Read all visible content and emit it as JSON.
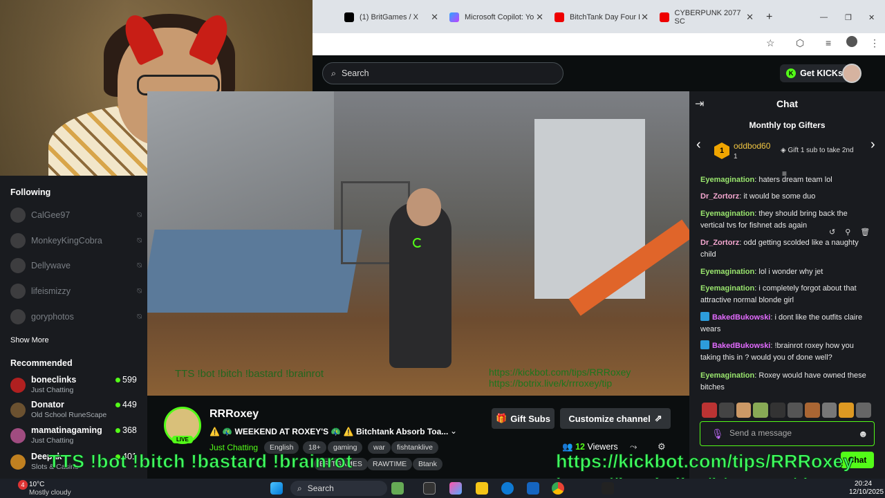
{
  "browser": {
    "tabs": [
      {
        "label": "(1) BritGames / X",
        "color": "#000000"
      },
      {
        "label": "Microsoft Copilot: Yo",
        "color": "#8a5cf6"
      },
      {
        "label": "BitchTank Day Four I",
        "color": "#53fc18"
      },
      {
        "label": "CYBERPUNK 2077 SC",
        "color": "#ff0000"
      }
    ]
  },
  "header": {
    "search_placeholder": "Search",
    "get_kicks_label": "Get KICKs"
  },
  "sidebar": {
    "following_heading": "Following",
    "following": [
      "CalGee97",
      "MonkeyKingCobra",
      "Dellywave",
      "lifeismizzy",
      "goryphotos"
    ],
    "show_more": "Show More",
    "recommended_heading": "Recommended",
    "recommended": [
      {
        "name": "boneclinks",
        "category": "Just Chatting",
        "viewers": "599"
      },
      {
        "name": "Donator",
        "category": "Old School RuneScape",
        "viewers": "449"
      },
      {
        "name": "mamatinagaming",
        "category": "Just Chatting",
        "viewers": "368"
      },
      {
        "name": "Deepak",
        "category": "Slots & Casino",
        "viewers": "401"
      }
    ]
  },
  "channel": {
    "name": "RRRoxey",
    "live_badge": "LIVE",
    "title": "⚠️ 🦚 WEEKEND AT ROXEY'S 🦚 ⚠️ Bitchtank Absorb Toa...",
    "category": "Just Chatting",
    "tags": [
      "English",
      "18+",
      "gaming",
      "war",
      "fishtanklive",
      "BRITGAMES",
      "RAWTIME",
      "Btank"
    ],
    "gift_subs_label": "Gift Subs",
    "customize_label": "Customize channel",
    "viewers_count": "12",
    "viewers_label": "Viewers"
  },
  "chat": {
    "title": "Chat",
    "gifters_title": "Monthly top Gifters",
    "top_gifter": {
      "rank": "1",
      "name": "oddbod60",
      "count": "1"
    },
    "gift_cta": "Gift 1 sub to take 2nd",
    "messages": [
      {
        "user": "Eyemagination",
        "text": "haters dream team lol",
        "color": "#9ae66e"
      },
      {
        "user": "Dr_Zortorz",
        "text": "it would be some duo",
        "color": "#f5a7d0"
      },
      {
        "user": "Eyemagination",
        "text": "they should bring back the vertical tvs for fishnet ads again",
        "color": "#9ae66e"
      },
      {
        "user": "Dr_Zortorz",
        "text": "odd getting scolded like a naughty child",
        "color": "#f5a7d0"
      },
      {
        "user": "Eyemagination",
        "text": "lol i wonder why jet",
        "color": "#9ae66e"
      },
      {
        "user": "Eyemagination",
        "text": "i completely forgot about that attractive normal blonde girl",
        "color": "#9ae66e"
      },
      {
        "user": "BakedBukowski",
        "text": "i dont like the outfits claire wears",
        "color": "#e36bff"
      },
      {
        "user": "BakedBukowski",
        "text": "!brainrot roxey how you taking this in ? would you of done well?",
        "color": "#e36bff"
      },
      {
        "user": "Eyemagination",
        "text": "Roxey would have owned these bitches",
        "color": "#9ae66e"
      }
    ],
    "input_placeholder": "Send a message",
    "send_label": "Chat"
  },
  "overlays": {
    "tts": "TTS !bot !bitch !bastard !brainrot",
    "url1": "https://kickbot.com/tips/RRRoxey",
    "url2": "https://botrix.live/k/rrroxey/tip"
  },
  "taskbar": {
    "weather_temp": "10°C",
    "weather_desc": "Mostly cloudy",
    "weather_alert": "4",
    "search_label": "Search",
    "time": "20:24",
    "date": "12/10/2025"
  },
  "colors": {
    "accent": "#53fc18",
    "background": "#0b0e0f",
    "panel": "#191b1f"
  }
}
